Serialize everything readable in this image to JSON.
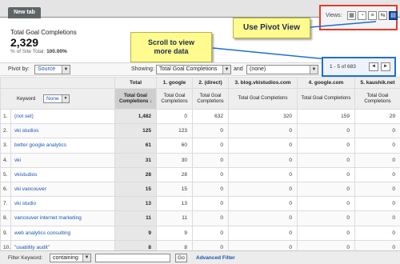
{
  "tab": {
    "label": "New tab"
  },
  "summary": {
    "metric_label": "Total Goal Completions",
    "metric_value": "2,329",
    "site_total_label": "% of Site Total:",
    "site_total_value": "100.00%"
  },
  "views": {
    "label": "Views:",
    "icons": [
      "table-view-icon",
      "pie-chart-icon",
      "bar-chart-icon",
      "comparison-view-icon",
      "pivot-view-icon"
    ],
    "active_icon": "pivot-view-icon"
  },
  "callouts": {
    "pivot": "Use Pivot View",
    "scroll_line1": "Scroll to view",
    "scroll_line2": "more data"
  },
  "pagination": {
    "range": "1 - 5 of 683",
    "prev": "◄",
    "next": "►"
  },
  "controls": {
    "pivot_by_label": "Pivot by:",
    "pivot_by_value": "Source",
    "showing_label": "Showing:",
    "showing_value": "Total Goal Completions",
    "and_label": "and",
    "and_value": "(none)"
  },
  "table": {
    "keyword_label": "Keyword",
    "keyword_select": "None",
    "total_header": "Total",
    "sources": [
      "1. google",
      "2. (direct)",
      "3. blog.vkistudios.com",
      "4. google.com",
      "5. kaushik.net"
    ],
    "metric_header": "Total Goal Completions",
    "rows": [
      {
        "num": "1.",
        "keyword": "(not set)",
        "total": "1,482",
        "values": [
          "0",
          "632",
          "320",
          "159",
          "29"
        ]
      },
      {
        "num": "2.",
        "keyword": "vki studios",
        "total": "125",
        "values": [
          "123",
          "0",
          "0",
          "0",
          "0"
        ]
      },
      {
        "num": "3.",
        "keyword": "better google analytics",
        "total": "61",
        "values": [
          "60",
          "0",
          "0",
          "0",
          "0"
        ]
      },
      {
        "num": "4.",
        "keyword": "vki",
        "total": "31",
        "values": [
          "30",
          "0",
          "0",
          "0",
          "0"
        ]
      },
      {
        "num": "5.",
        "keyword": "vkistudios",
        "total": "28",
        "values": [
          "28",
          "0",
          "0",
          "0",
          "0"
        ]
      },
      {
        "num": "6.",
        "keyword": "vki vancouver",
        "total": "15",
        "values": [
          "15",
          "0",
          "0",
          "0",
          "0"
        ]
      },
      {
        "num": "7.",
        "keyword": "vki studio",
        "total": "13",
        "values": [
          "13",
          "0",
          "0",
          "0",
          "0"
        ]
      },
      {
        "num": "8.",
        "keyword": "vancouver internet marketing",
        "total": "11",
        "values": [
          "11",
          "0",
          "0",
          "0",
          "0"
        ]
      },
      {
        "num": "9.",
        "keyword": "web analytics consulting",
        "total": "9",
        "values": [
          "9",
          "0",
          "0",
          "0",
          "0"
        ]
      },
      {
        "num": "10.",
        "keyword": "\"usability audit\"",
        "total": "8",
        "values": [
          "8",
          "0",
          "0",
          "0",
          "0"
        ]
      }
    ]
  },
  "filter": {
    "label": "Filter Keyword:",
    "mode": "containing",
    "input_value": "",
    "go": "Go",
    "advanced": "Advanced Filter"
  },
  "colors": {
    "views_highlight": "#e8392b",
    "scroll_highlight": "#1f6fd1",
    "callout_bg": "#fffb8f",
    "link": "#1a55b3"
  }
}
